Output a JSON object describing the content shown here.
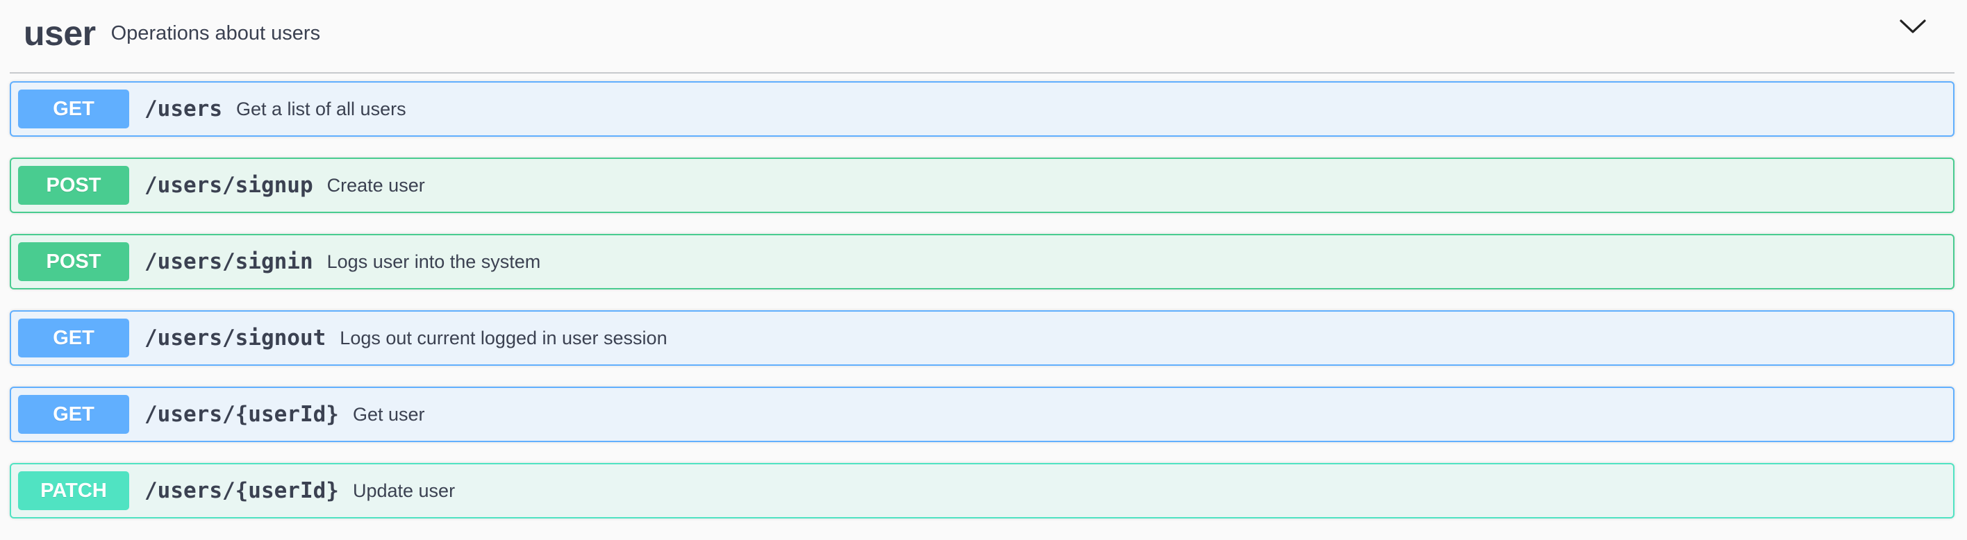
{
  "tag": {
    "name": "user",
    "description": "Operations about users"
  },
  "operations": [
    {
      "method": "GET",
      "path": "/users",
      "summary": "Get a list of all users",
      "type": "get"
    },
    {
      "method": "POST",
      "path": "/users/signup",
      "summary": "Create user",
      "type": "post"
    },
    {
      "method": "POST",
      "path": "/users/signin",
      "summary": "Logs user into the system",
      "type": "post"
    },
    {
      "method": "GET",
      "path": "/users/signout",
      "summary": "Logs out current logged in user session",
      "type": "get"
    },
    {
      "method": "GET",
      "path": "/users/{userId}",
      "summary": "Get user",
      "type": "get"
    },
    {
      "method": "PATCH",
      "path": "/users/{userId}",
      "summary": "Update user",
      "type": "patch"
    }
  ],
  "icons": {
    "collapse": "chevron-down-icon"
  },
  "colors": {
    "get": "#61affe",
    "post": "#49cc90",
    "patch": "#50e3c2",
    "text": "#3b4151"
  }
}
